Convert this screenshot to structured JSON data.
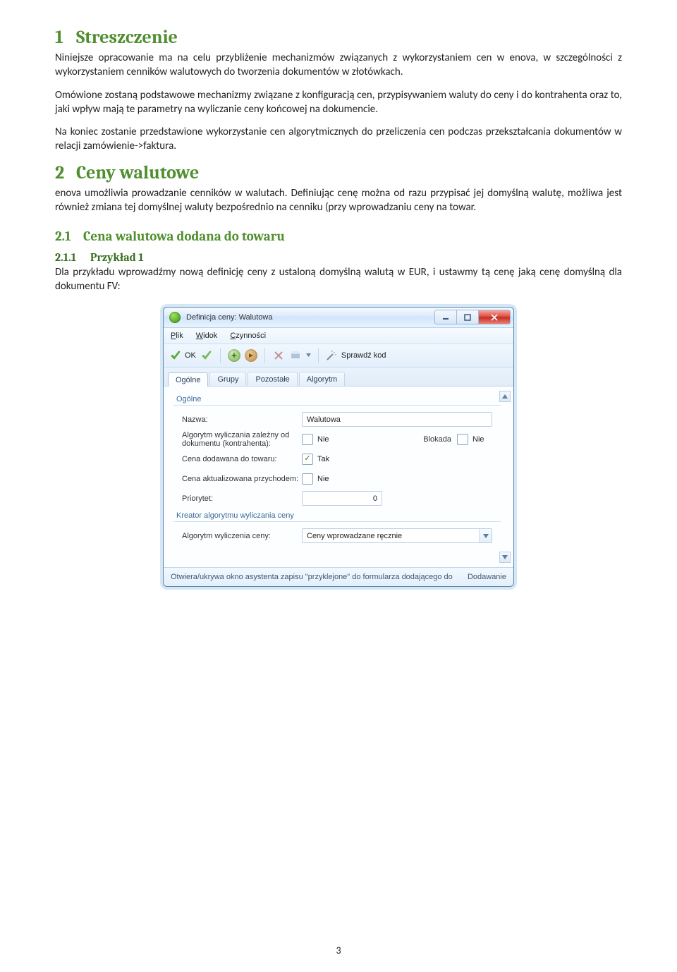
{
  "page_number": "3",
  "section1": {
    "num": "1",
    "title": "Streszczenie",
    "p1": "Niniejsze opracowanie ma na celu przybliżenie mechanizmów związanych z wykorzystaniem cen w enova, w szczególności z wykorzystaniem cenników walutowych do tworzenia dokumentów w złotówkach.",
    "p2": "Omówione zostaną podstawowe mechanizmy związane z konfiguracją cen, przypisywaniem waluty do ceny i do kontrahenta oraz to, jaki wpływ mają te parametry na wyliczanie ceny końcowej na dokumencie.",
    "p3": "Na koniec zostanie przedstawione wykorzystanie cen algorytmicznych do przeliczenia cen podczas przekształcania dokumentów w relacji zamówienie->faktura."
  },
  "section2": {
    "num": "2",
    "title": "Ceny walutowe",
    "p1": "enova umożliwia prowadzanie cenników w walutach. Definiując cenę można od razu przypisać jej domyślną walutę, możliwa jest również zmiana tej domyślnej waluty bezpośrednio na cenniku (przy wprowadzaniu ceny na towar."
  },
  "section2_1": {
    "num": "2.1",
    "title": "Cena walutowa dodana do towaru"
  },
  "section2_1_1": {
    "num": "2.1.1",
    "title": "Przykład 1",
    "p1": "Dla przykładu wprowadźmy nową definicję ceny z ustaloną domyślną walutą w EUR, i ustawmy tą cenę jaką cenę domyślną dla dokumentu FV:"
  },
  "win": {
    "title": "Definicja ceny: Walutowa",
    "menubar": {
      "plik": "Plik",
      "widok": "Widok",
      "czynnosci": "Czynności"
    },
    "toolbar": {
      "ok": "OK",
      "sprawdz": "Sprawdź kod"
    },
    "tabs": [
      "Ogólne",
      "Grupy",
      "Pozostałe",
      "Algorytm"
    ],
    "group1": "Ogólne",
    "group2": "Kreator algorytmu wyliczania ceny",
    "labels": {
      "nazwa": "Nazwa:",
      "alg_zalezny": "Algorytm wyliczania zależny od dokumentu (kontrahenta):",
      "blokada": "Blokada",
      "cena_dodawana": "Cena dodawana do towaru:",
      "cena_akt": "Cena aktualizowana przychodem:",
      "priorytet": "Priorytet:",
      "alg_wyliczenia": "Algorytm wyliczenia ceny:"
    },
    "values": {
      "nazwa": "Walutowa",
      "tak": "Tak",
      "nie": "Nie",
      "priorytet": "0",
      "alg_wyliczenia": "Ceny wprowadzane ręcznie"
    },
    "status_left": "Otwiera/ukrywa okno asystenta zapisu \"przyklejone\" do formularza dodającego do",
    "status_right": "Dodawanie"
  }
}
